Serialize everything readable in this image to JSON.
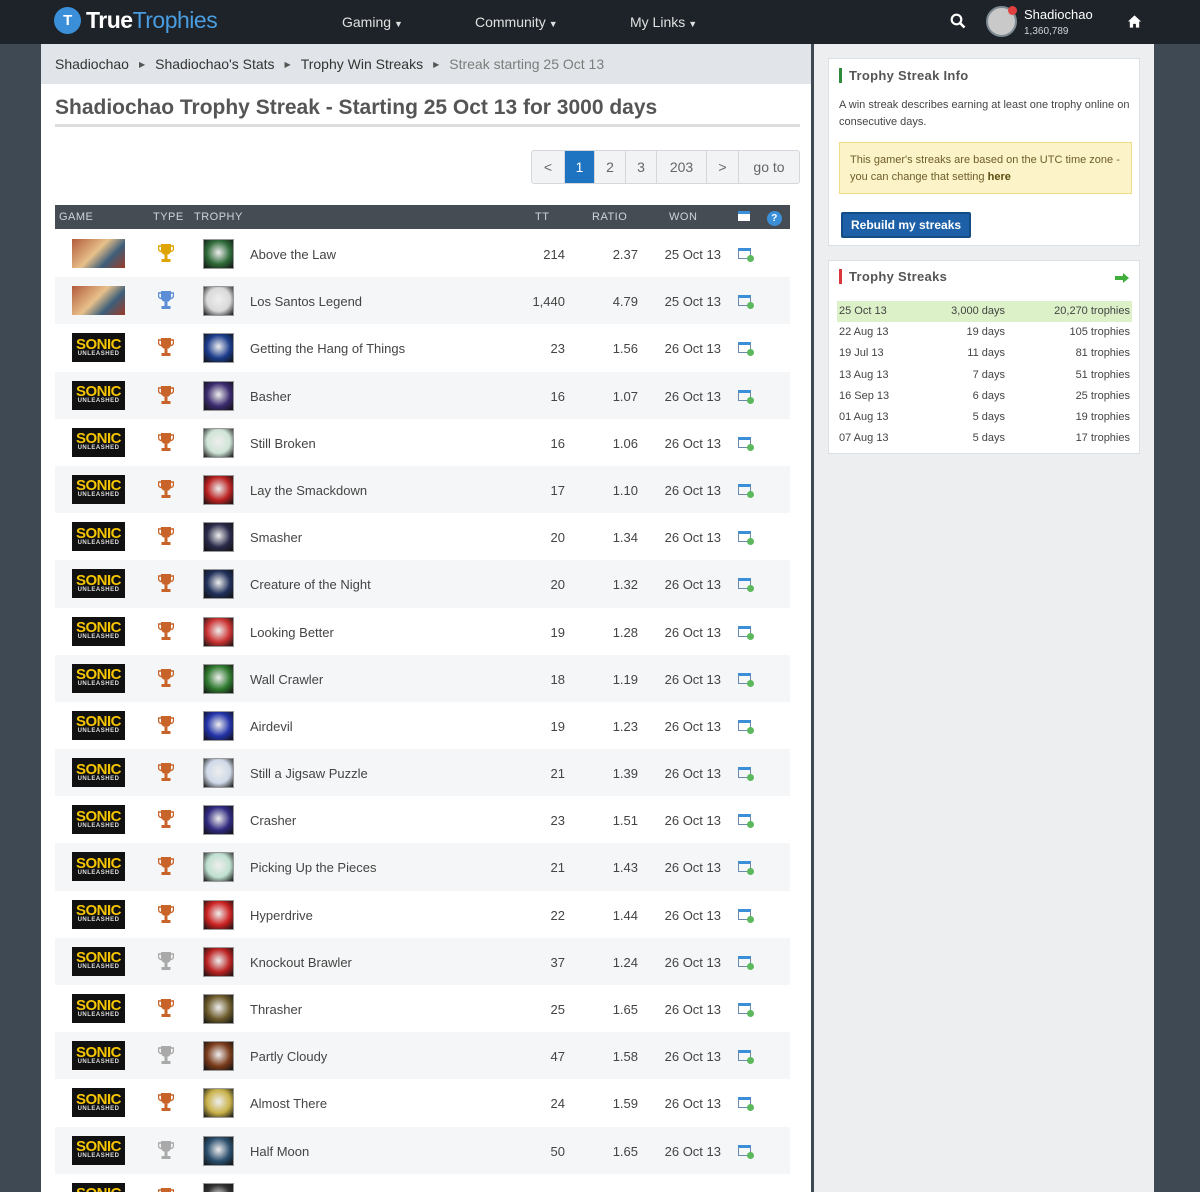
{
  "header": {
    "logo_true": "True",
    "logo_trophies": "Trophies",
    "logo_badge": "T",
    "nav": [
      {
        "label": "Gaming"
      },
      {
        "label": "Community"
      },
      {
        "label": "My Links"
      }
    ],
    "username": "Shadiochao",
    "user_score": "1,360,789"
  },
  "breadcrumb": [
    "Shadiochao",
    "Shadiochao's Stats",
    "Trophy Win Streaks",
    "Streak starting 25 Oct 13"
  ],
  "page_title": "Shadiochao Trophy Streak - Starting 25 Oct 13 for 3000 days",
  "pagination": {
    "prev": "<",
    "pages": [
      "1",
      "2",
      "3"
    ],
    "last": "203",
    "next": ">",
    "goto": "go to",
    "active": "1"
  },
  "table": {
    "headers": {
      "game": "GAME",
      "type": "TYPE",
      "trophy": "TROPHY",
      "tt": "TT",
      "ratio": "RATIO",
      "won": "WON"
    },
    "help_icon": "?",
    "rows": [
      {
        "game": "gta",
        "cup": "gold",
        "trophy": "Above the Law",
        "tt": "214",
        "ratio": "2.37",
        "won": "25 Oct 13"
      },
      {
        "game": "gta",
        "cup": "platinum",
        "trophy": "Los Santos Legend",
        "tt": "1,440",
        "ratio": "4.79",
        "won": "25 Oct 13"
      },
      {
        "game": "sonic",
        "cup": "bronze",
        "trophy": "Getting the Hang of Things",
        "tt": "23",
        "ratio": "1.56",
        "won": "26 Oct 13"
      },
      {
        "game": "sonic",
        "cup": "bronze",
        "trophy": "Basher",
        "tt": "16",
        "ratio": "1.07",
        "won": "26 Oct 13"
      },
      {
        "game": "sonic",
        "cup": "bronze",
        "trophy": "Still Broken",
        "tt": "16",
        "ratio": "1.06",
        "won": "26 Oct 13"
      },
      {
        "game": "sonic",
        "cup": "bronze",
        "trophy": "Lay the Smackdown",
        "tt": "17",
        "ratio": "1.10",
        "won": "26 Oct 13"
      },
      {
        "game": "sonic",
        "cup": "bronze",
        "trophy": "Smasher",
        "tt": "20",
        "ratio": "1.34",
        "won": "26 Oct 13"
      },
      {
        "game": "sonic",
        "cup": "bronze",
        "trophy": "Creature of the Night",
        "tt": "20",
        "ratio": "1.32",
        "won": "26 Oct 13"
      },
      {
        "game": "sonic",
        "cup": "bronze",
        "trophy": "Looking Better",
        "tt": "19",
        "ratio": "1.28",
        "won": "26 Oct 13"
      },
      {
        "game": "sonic",
        "cup": "bronze",
        "trophy": "Wall Crawler",
        "tt": "18",
        "ratio": "1.19",
        "won": "26 Oct 13"
      },
      {
        "game": "sonic",
        "cup": "bronze",
        "trophy": "Airdevil",
        "tt": "19",
        "ratio": "1.23",
        "won": "26 Oct 13"
      },
      {
        "game": "sonic",
        "cup": "bronze",
        "trophy": "Still a Jigsaw Puzzle",
        "tt": "21",
        "ratio": "1.39",
        "won": "26 Oct 13"
      },
      {
        "game": "sonic",
        "cup": "bronze",
        "trophy": "Crasher",
        "tt": "23",
        "ratio": "1.51",
        "won": "26 Oct 13"
      },
      {
        "game": "sonic",
        "cup": "bronze",
        "trophy": "Picking Up the Pieces",
        "tt": "21",
        "ratio": "1.43",
        "won": "26 Oct 13"
      },
      {
        "game": "sonic",
        "cup": "bronze",
        "trophy": "Hyperdrive",
        "tt": "22",
        "ratio": "1.44",
        "won": "26 Oct 13"
      },
      {
        "game": "sonic",
        "cup": "silver",
        "trophy": "Knockout Brawler",
        "tt": "37",
        "ratio": "1.24",
        "won": "26 Oct 13"
      },
      {
        "game": "sonic",
        "cup": "bronze",
        "trophy": "Thrasher",
        "tt": "25",
        "ratio": "1.65",
        "won": "26 Oct 13"
      },
      {
        "game": "sonic",
        "cup": "silver",
        "trophy": "Partly Cloudy",
        "tt": "47",
        "ratio": "1.58",
        "won": "26 Oct 13"
      },
      {
        "game": "sonic",
        "cup": "bronze",
        "trophy": "Almost There",
        "tt": "24",
        "ratio": "1.59",
        "won": "26 Oct 13"
      },
      {
        "game": "sonic",
        "cup": "silver",
        "trophy": "Half Moon",
        "tt": "50",
        "ratio": "1.65",
        "won": "26 Oct 13"
      },
      {
        "game": "sonic",
        "cup": "bronze",
        "trophy": "",
        "tt": "",
        "ratio": "",
        "won": ""
      }
    ]
  },
  "sonic_logo": {
    "top": "SONIC",
    "bottom": "UNLEASHED"
  },
  "streak_info": {
    "title": "Trophy Streak Info",
    "description": "A win streak describes earning at least one trophy online on consecutive days.",
    "note_text": "This gamer's streaks are based on the UTC time zone - you can change that setting",
    "note_link": "here",
    "rebuild_label": "Rebuild my streaks"
  },
  "trophy_streaks": {
    "title": "Trophy Streaks",
    "rows": [
      {
        "start": "25 Oct 13",
        "days": "3,000 days",
        "trophies": "20,270 trophies"
      },
      {
        "start": "22 Aug 13",
        "days": "19 days",
        "trophies": "105 trophies"
      },
      {
        "start": "19 Jul 13",
        "days": "11 days",
        "trophies": "81 trophies"
      },
      {
        "start": "13 Aug 13",
        "days": "7 days",
        "trophies": "51 trophies"
      },
      {
        "start": "16 Sep 13",
        "days": "6 days",
        "trophies": "25 trophies"
      },
      {
        "start": "01 Aug 13",
        "days": "5 days",
        "trophies": "19 trophies"
      },
      {
        "start": "07 Aug 13",
        "days": "5 days",
        "trophies": "17 trophies"
      }
    ]
  },
  "colors": {
    "gold": "#e0a400",
    "platinum": "#5b8ed6",
    "bronze": "#c8642a",
    "silver": "#a9a9a9",
    "accent": "#1e74c0"
  }
}
